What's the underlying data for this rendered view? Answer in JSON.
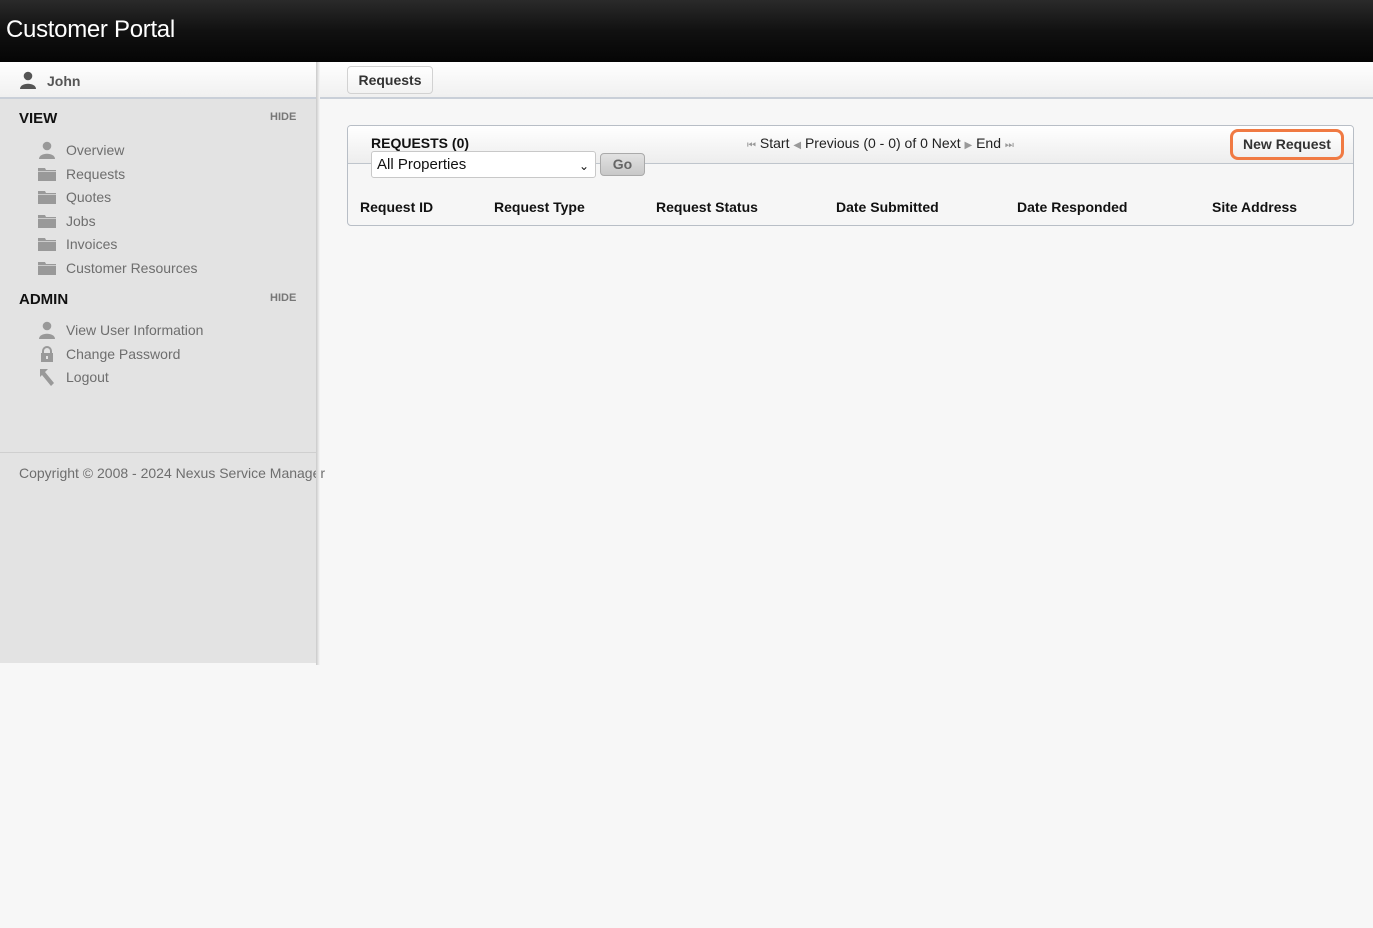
{
  "header": {
    "title": "Customer Portal"
  },
  "user": {
    "name": "John",
    "icon": "user-icon"
  },
  "sidebar": {
    "view": {
      "title": "VIEW",
      "hide_label": "HIDE",
      "items": [
        {
          "label": "Overview",
          "icon": "user-icon"
        },
        {
          "label": "Requests",
          "icon": "folder-icon"
        },
        {
          "label": "Quotes",
          "icon": "folder-icon"
        },
        {
          "label": "Jobs",
          "icon": "folder-icon"
        },
        {
          "label": "Invoices",
          "icon": "folder-icon"
        },
        {
          "label": "Customer Resources",
          "icon": "folder-icon"
        }
      ]
    },
    "admin": {
      "title": "ADMIN",
      "hide_label": "HIDE",
      "items": [
        {
          "label": "View User Information",
          "icon": "user-icon"
        },
        {
          "label": "Change Password",
          "icon": "lock-icon"
        },
        {
          "label": "Logout",
          "icon": "arrow-up-left-icon"
        }
      ]
    },
    "copyright": "Copyright © 2008 - 2024 Nexus Service Manager"
  },
  "tabs": [
    {
      "label": "Requests",
      "active": true
    }
  ],
  "panel": {
    "title": "REQUESTS (0)",
    "pager": {
      "start": "Start",
      "previous": "Previous",
      "range": "(0 - 0) of 0",
      "next": "Next",
      "end": "End"
    },
    "new_request_label": "New Request",
    "filter": {
      "selected": "All Properties"
    },
    "go_label": "Go",
    "columns": [
      "Request ID",
      "Request Type",
      "Request Status",
      "Date Submitted",
      "Date Responded",
      "Site Address"
    ],
    "rows": []
  },
  "colors": {
    "highlight": "#f07a43",
    "header_bg": "#111111",
    "sidebar_bg": "#e3e3e3"
  }
}
